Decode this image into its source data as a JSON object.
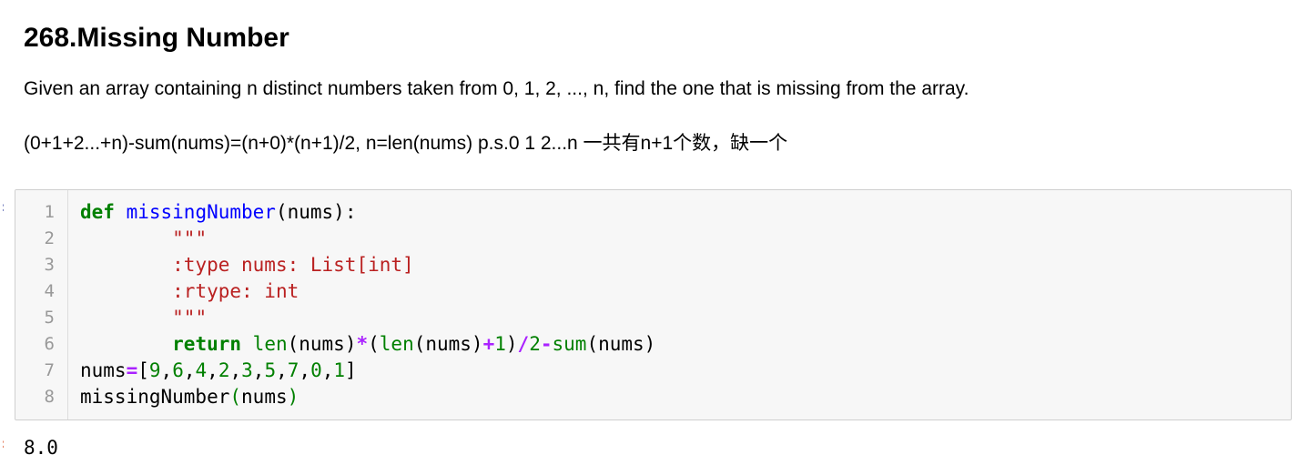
{
  "markdown": {
    "title": "268.Missing Number",
    "paragraph1": "Given an array containing n distinct numbers taken from 0, 1, 2, ..., n, find the one that is missing from the array.",
    "paragraph2": "(0+1+2...+n)-sum(nums)=(n+0)*(n+1)/2, n=len(nums) p.s.0 1 2...n 一共有n+1个数，缺一个"
  },
  "code_cell": {
    "line_numbers": [
      "1",
      "2",
      "3",
      "4",
      "5",
      "6",
      "7",
      "8"
    ],
    "lines": [
      [
        {
          "t": "def",
          "c": "kw"
        },
        {
          "t": " ",
          "c": "pn"
        },
        {
          "t": "missingNumber",
          "c": "fn"
        },
        {
          "t": "(nums):",
          "c": "pn"
        }
      ],
      [
        {
          "t": "        ",
          "c": "pn"
        },
        {
          "t": "\"\"\"",
          "c": "str"
        }
      ],
      [
        {
          "t": "        ",
          "c": "pn"
        },
        {
          "t": ":type nums: List[int]",
          "c": "str"
        }
      ],
      [
        {
          "t": "        ",
          "c": "pn"
        },
        {
          "t": ":rtype: int",
          "c": "str"
        }
      ],
      [
        {
          "t": "        ",
          "c": "pn"
        },
        {
          "t": "\"\"\"",
          "c": "str"
        }
      ],
      [
        {
          "t": "        ",
          "c": "pn"
        },
        {
          "t": "return",
          "c": "kw"
        },
        {
          "t": " ",
          "c": "pn"
        },
        {
          "t": "len",
          "c": "bi"
        },
        {
          "t": "(nums)",
          "c": "pn"
        },
        {
          "t": "*",
          "c": "op"
        },
        {
          "t": "(",
          "c": "pn"
        },
        {
          "t": "len",
          "c": "bi"
        },
        {
          "t": "(nums)",
          "c": "pn"
        },
        {
          "t": "+",
          "c": "op"
        },
        {
          "t": "1",
          "c": "num"
        },
        {
          "t": ")",
          "c": "pn"
        },
        {
          "t": "/",
          "c": "op"
        },
        {
          "t": "2",
          "c": "num"
        },
        {
          "t": "-",
          "c": "op"
        },
        {
          "t": "sum",
          "c": "bi"
        },
        {
          "t": "(nums)",
          "c": "pn"
        }
      ],
      [
        {
          "t": "nums",
          "c": "pn"
        },
        {
          "t": "=",
          "c": "op"
        },
        {
          "t": "[",
          "c": "pn"
        },
        {
          "t": "9",
          "c": "num"
        },
        {
          "t": ",",
          "c": "pn"
        },
        {
          "t": "6",
          "c": "num"
        },
        {
          "t": ",",
          "c": "pn"
        },
        {
          "t": "4",
          "c": "num"
        },
        {
          "t": ",",
          "c": "pn"
        },
        {
          "t": "2",
          "c": "num"
        },
        {
          "t": ",",
          "c": "pn"
        },
        {
          "t": "3",
          "c": "num"
        },
        {
          "t": ",",
          "c": "pn"
        },
        {
          "t": "5",
          "c": "num"
        },
        {
          "t": ",",
          "c": "pn"
        },
        {
          "t": "7",
          "c": "num"
        },
        {
          "t": ",",
          "c": "pn"
        },
        {
          "t": "0",
          "c": "num"
        },
        {
          "t": ",",
          "c": "pn"
        },
        {
          "t": "1",
          "c": "num"
        },
        {
          "t": "]",
          "c": "pn"
        }
      ],
      [
        {
          "t": "missingNumber",
          "c": "pn"
        },
        {
          "t": "(",
          "c": "cursor-bracket"
        },
        {
          "t": "nums",
          "c": "pn"
        },
        {
          "t": ")",
          "c": "cursor-bracket"
        }
      ]
    ]
  },
  "output": {
    "text": "8.0"
  },
  "colors": {
    "keyword": "#008000",
    "function_name": "#0000ff",
    "string": "#ba2121",
    "operator": "#aa22ff",
    "number": "#008000",
    "cell_background": "#f7f7f7",
    "cell_border": "#cfcfcf",
    "line_number": "#999999"
  }
}
